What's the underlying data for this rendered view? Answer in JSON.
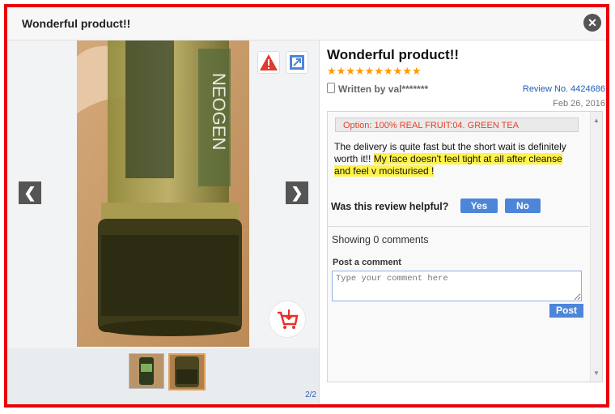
{
  "window": {
    "title": "Wonderful product!!",
    "close_label": "✕"
  },
  "gallery": {
    "counter": "2/2",
    "prev_label": "❮",
    "next_label": "❯"
  },
  "review": {
    "title": "Wonderful product!!",
    "rating": 10,
    "author": "Written by val*******",
    "review_no": "Review No. 4424686",
    "date": "Feb 26, 2016",
    "option": "Option: 100% REAL FRUIT:04. GREEN TEA",
    "text_part1": "The delivery is quite fast but the short wait is definitely worth it!! ",
    "text_highlight": "My face doesn't feel tight at all after cleanse and feel v moisturised !",
    "helpful_question": "Was this review helpful?",
    "yes_label": "Yes",
    "no_label": "No"
  },
  "comments": {
    "count_label": "Showing 0 comments",
    "post_heading": "Post a comment",
    "placeholder": "Type your comment here",
    "post_button": "Post"
  },
  "colors": {
    "border": "#e8000b",
    "accent": "#4d86d9",
    "star": "#ff9a00",
    "highlight": "#fff24a"
  }
}
